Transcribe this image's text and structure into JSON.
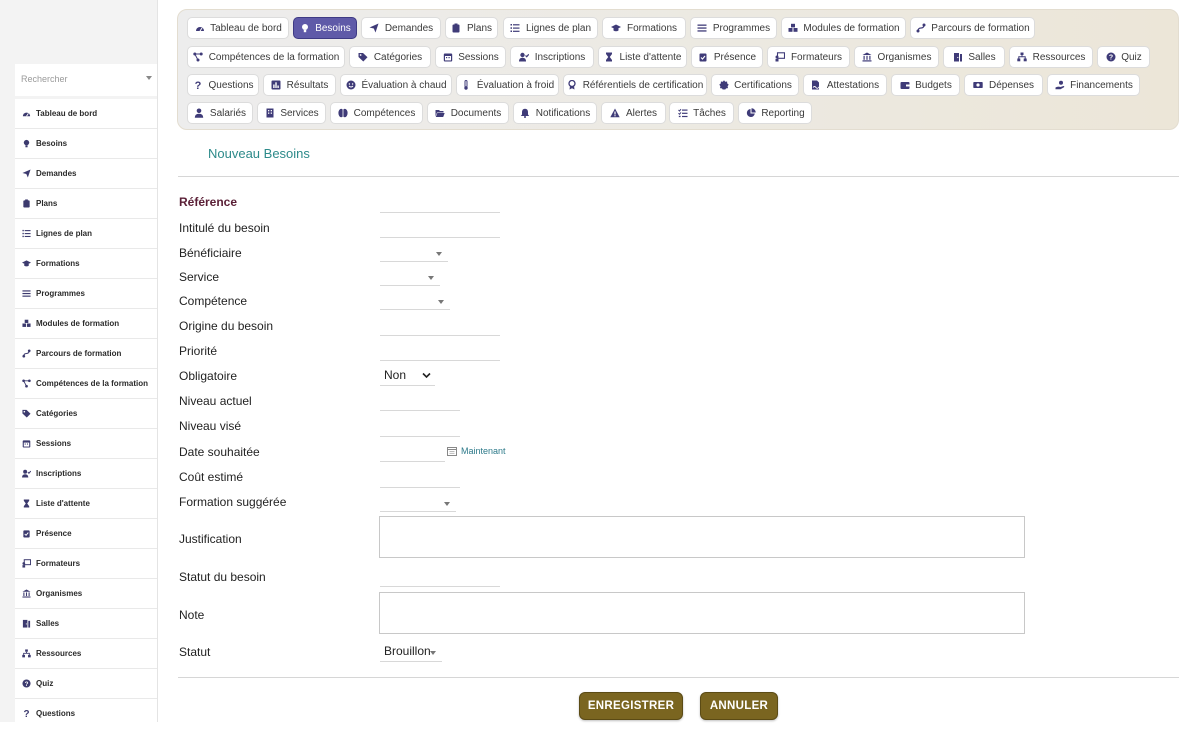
{
  "sidebar": {
    "search_placeholder": "Rechercher",
    "items": [
      {
        "label": "Tableau de bord",
        "icon": "dashboard-icon"
      },
      {
        "label": "Besoins",
        "icon": "lightbulb-icon"
      },
      {
        "label": "Demandes",
        "icon": "paper-plane-icon"
      },
      {
        "label": "Plans",
        "icon": "clipboard-icon"
      },
      {
        "label": "Lignes de plan",
        "icon": "list-icon"
      },
      {
        "label": "Formations",
        "icon": "graduation-cap-icon"
      },
      {
        "label": "Programmes",
        "icon": "bars-icon"
      },
      {
        "label": "Modules de formation",
        "icon": "cubes-icon"
      },
      {
        "label": "Parcours de formation",
        "icon": "route-icon"
      },
      {
        "label": "Compétences de la formation",
        "icon": "network-icon"
      },
      {
        "label": "Catégories",
        "icon": "tags-icon"
      },
      {
        "label": "Sessions",
        "icon": "calendar-icon"
      },
      {
        "label": "Inscriptions",
        "icon": "user-check-icon"
      },
      {
        "label": "Liste d'attente",
        "icon": "hourglass-icon"
      },
      {
        "label": "Présence",
        "icon": "clipboard-check-icon"
      },
      {
        "label": "Formateurs",
        "icon": "chalkboard-teacher-icon"
      },
      {
        "label": "Organismes",
        "icon": "institution-icon"
      },
      {
        "label": "Salles",
        "icon": "door-icon"
      },
      {
        "label": "Ressources",
        "icon": "sitemap-icon"
      },
      {
        "label": "Quiz",
        "icon": "question-circle-icon"
      },
      {
        "label": "Questions",
        "icon": "question-icon"
      }
    ]
  },
  "topbar": {
    "tabs": [
      {
        "label": "Tableau de bord",
        "icon": "dashboard-icon"
      },
      {
        "label": "Besoins",
        "icon": "lightbulb-icon"
      },
      {
        "label": "Demandes",
        "icon": "paper-plane-icon"
      },
      {
        "label": "Plans",
        "icon": "clipboard-icon"
      },
      {
        "label": "Lignes de plan",
        "icon": "list-icon"
      },
      {
        "label": "Formations",
        "icon": "graduation-cap-icon"
      },
      {
        "label": "Programmes",
        "icon": "bars-icon"
      },
      {
        "label": "Modules de formation",
        "icon": "cubes-icon"
      },
      {
        "label": "Parcours de formation",
        "icon": "route-icon"
      },
      {
        "label": "Compétences de la formation",
        "icon": "network-icon"
      },
      {
        "label": "Catégories",
        "icon": "tags-icon"
      },
      {
        "label": "Sessions",
        "icon": "calendar-icon"
      },
      {
        "label": "Inscriptions",
        "icon": "user-check-icon"
      },
      {
        "label": "Liste d'attente",
        "icon": "hourglass-icon"
      },
      {
        "label": "Présence",
        "icon": "clipboard-check-icon"
      },
      {
        "label": "Formateurs",
        "icon": "chalkboard-teacher-icon"
      },
      {
        "label": "Organismes",
        "icon": "institution-icon"
      },
      {
        "label": "Salles",
        "icon": "door-icon"
      },
      {
        "label": "Ressources",
        "icon": "sitemap-icon"
      },
      {
        "label": "Quiz",
        "icon": "question-circle-icon"
      },
      {
        "label": "Questions",
        "icon": "question-icon"
      },
      {
        "label": "Résultats",
        "icon": "poll-icon"
      },
      {
        "label": "Évaluation à chaud",
        "icon": "smile-icon"
      },
      {
        "label": "Évaluation à froid",
        "icon": "thermometer-icon"
      },
      {
        "label": "Référentiels de certification",
        "icon": "award-icon"
      },
      {
        "label": "Certifications",
        "icon": "certificate-icon"
      },
      {
        "label": "Attestations",
        "icon": "file-signature-icon"
      },
      {
        "label": "Budgets",
        "icon": "wallet-icon"
      },
      {
        "label": "Dépenses",
        "icon": "money-bill-icon"
      },
      {
        "label": "Financements",
        "icon": "hand-holding-icon"
      },
      {
        "label": "Salariés",
        "icon": "user-icon"
      },
      {
        "label": "Services",
        "icon": "building-icon"
      },
      {
        "label": "Compétences",
        "icon": "brain-icon"
      },
      {
        "label": "Documents",
        "icon": "folder-open-icon"
      },
      {
        "label": "Notifications",
        "icon": "bell-icon"
      },
      {
        "label": "Alertes",
        "icon": "warning-icon"
      },
      {
        "label": "Tâches",
        "icon": "tasks-icon"
      },
      {
        "label": "Reporting",
        "icon": "chart-pie-icon"
      }
    ],
    "active_index": 1
  },
  "form": {
    "title": "Nouveau Besoins",
    "labels": {
      "reference": "Référence",
      "intitule": "Intitulé du besoin",
      "beneficiaire": "Bénéficiaire",
      "service": "Service",
      "competence": "Compétence",
      "origine": "Origine du besoin",
      "priorite": "Priorité",
      "obligatoire": "Obligatoire",
      "niveau_actuel": "Niveau actuel",
      "niveau_vise": "Niveau visé",
      "date_souhaitee": "Date souhaitée",
      "cout_estime": "Coût estimé",
      "formation_suggeree": "Formation suggérée",
      "justification": "Justification",
      "statut_besoin": "Statut du besoin",
      "note": "Note",
      "statut": "Statut"
    },
    "values": {
      "reference": "",
      "intitule": "",
      "beneficiaire": "",
      "service": "",
      "competence": "",
      "origine": "",
      "priorite": "",
      "obligatoire": "Non",
      "niveau_actuel": "",
      "niveau_vise": "",
      "date_souhaitee": "",
      "cout_estime": "",
      "formation_suggeree": "",
      "justification": "",
      "statut_besoin": "",
      "note": "",
      "statut": "Brouillon"
    },
    "now_link": "Maintenant",
    "save_label": "ENREGISTRER",
    "cancel_label": "ANNULER"
  },
  "colors": {
    "accent_active_tab": "#5f5aa8",
    "button_bg": "#7a6520",
    "title_teal": "#2d8a8a",
    "required_label": "#5a1f36"
  }
}
